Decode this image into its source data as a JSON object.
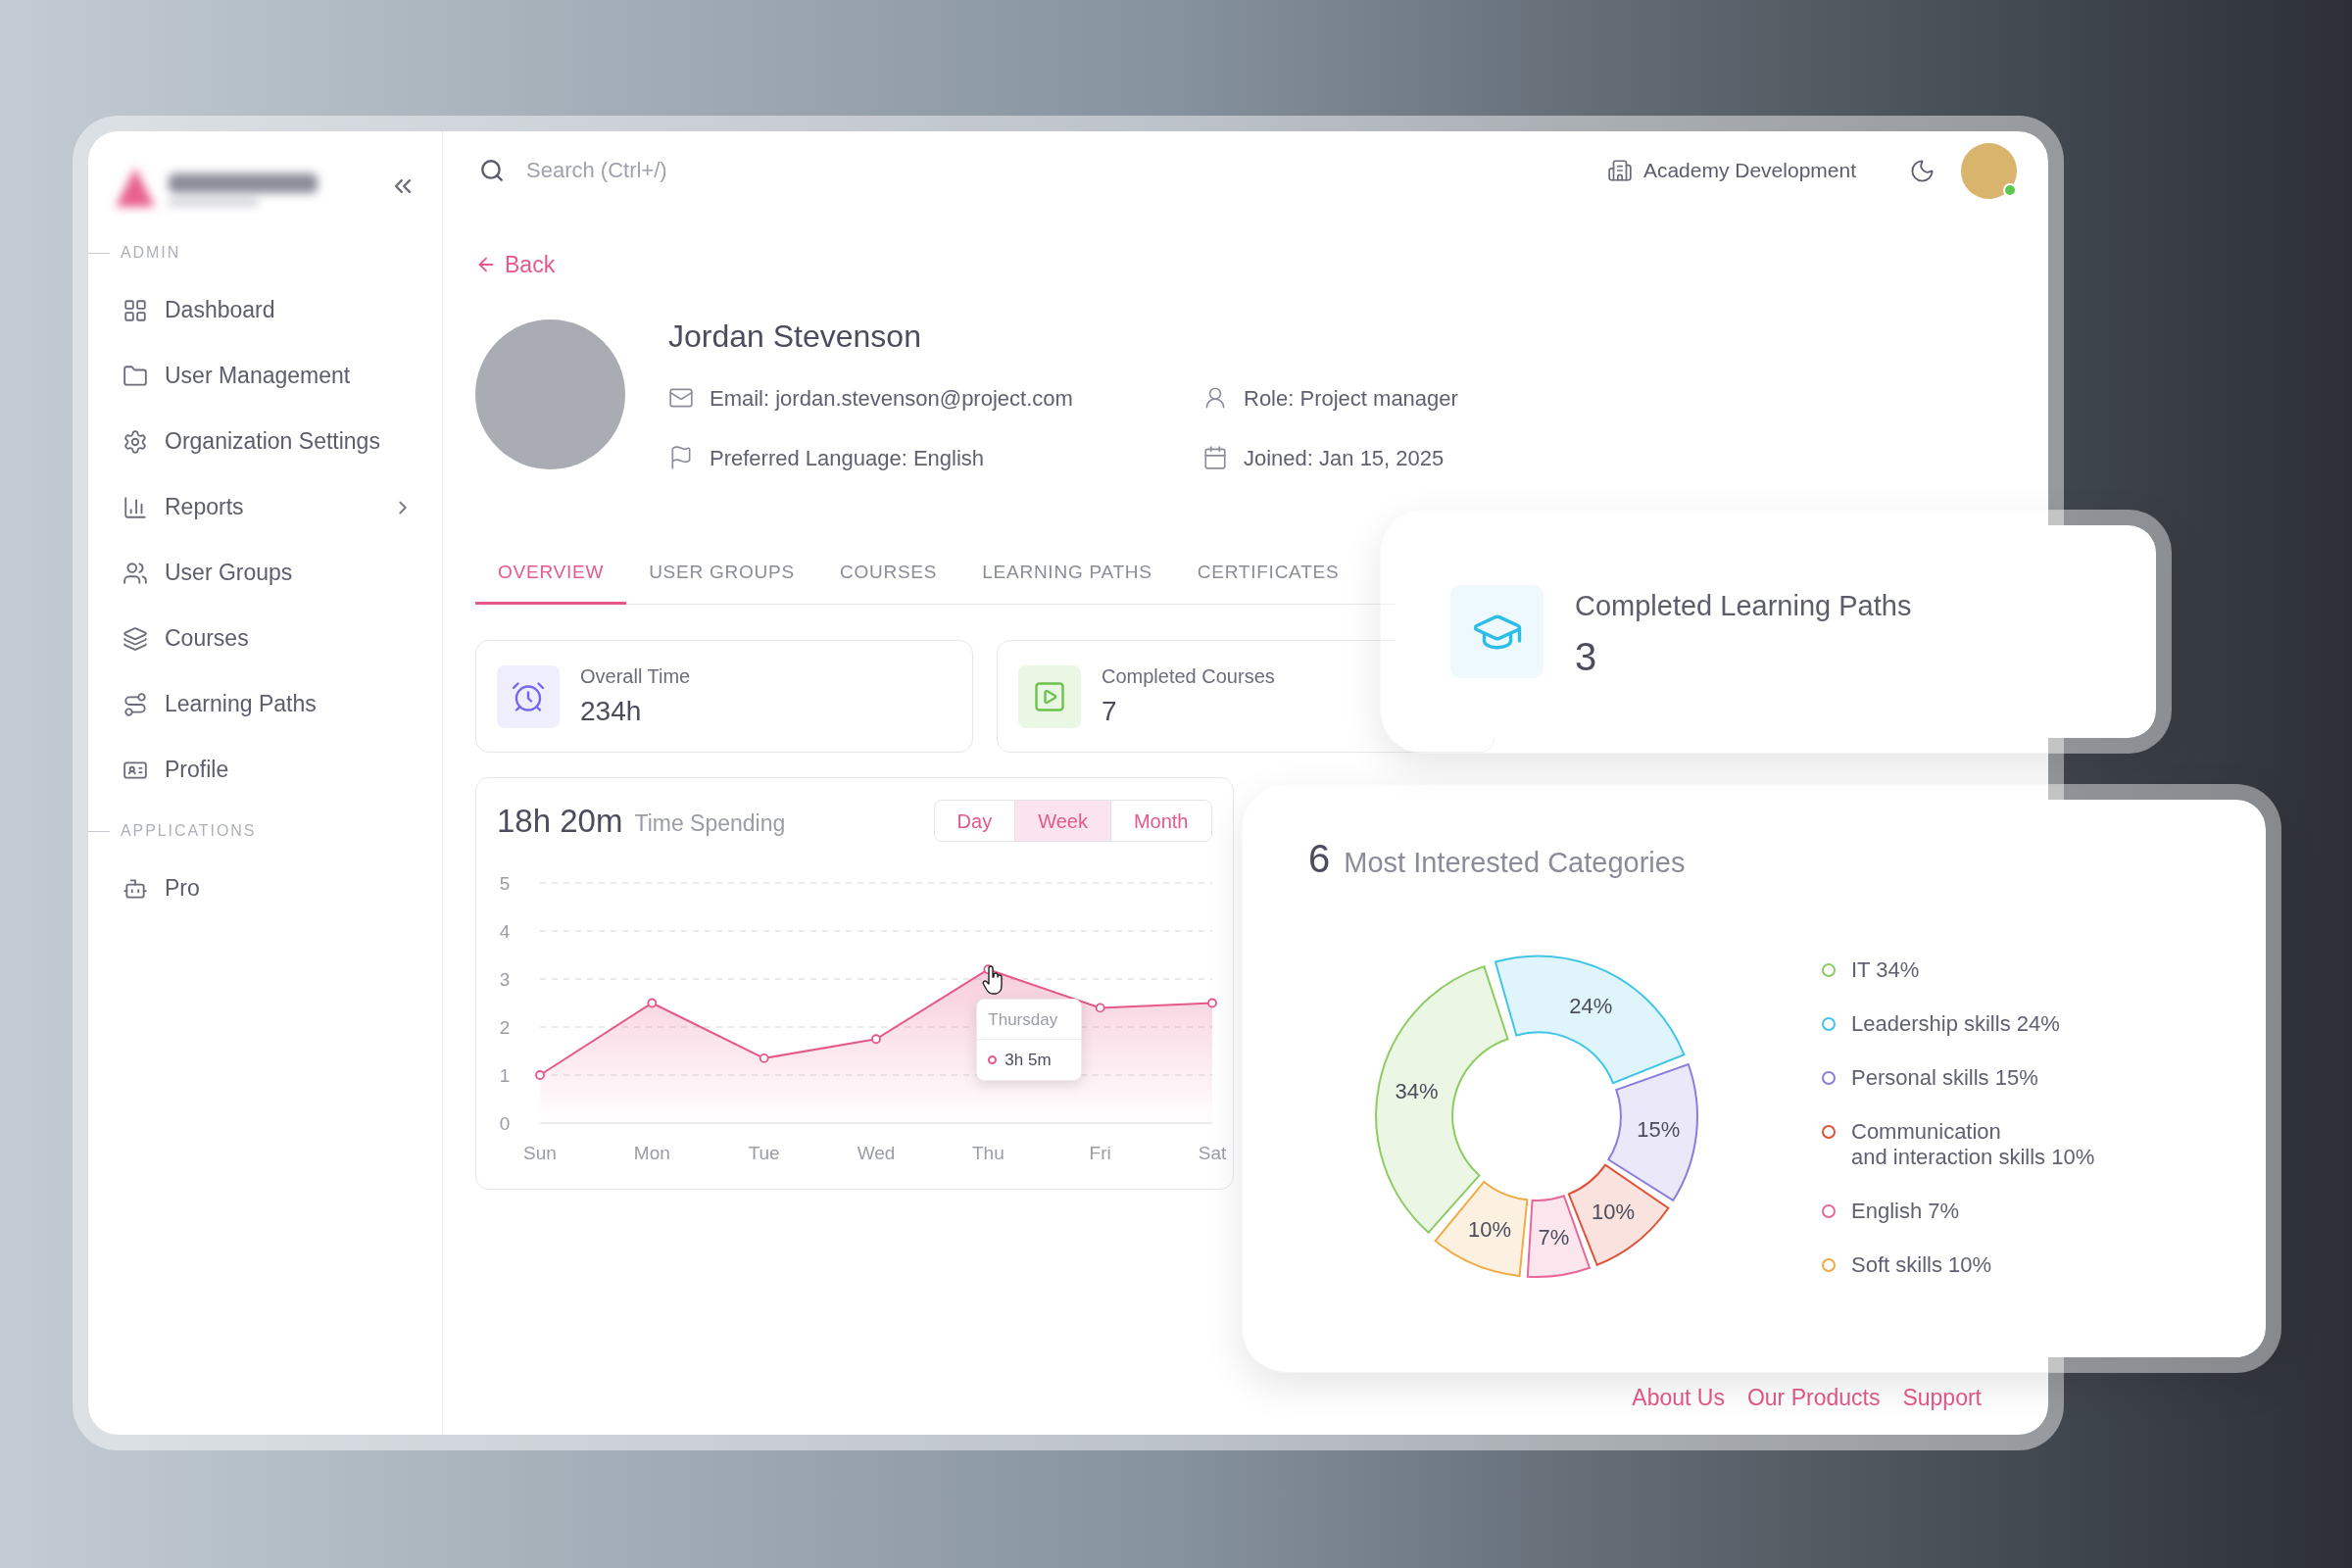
{
  "sidebar": {
    "sections": [
      {
        "title": "ADMIN",
        "items": [
          {
            "label": "Dashboard",
            "has_submenu": false
          },
          {
            "label": "User Management",
            "has_submenu": false
          },
          {
            "label": "Organization Settings",
            "has_submenu": false
          },
          {
            "label": "Reports",
            "has_submenu": true
          },
          {
            "label": "User Groups",
            "has_submenu": false
          },
          {
            "label": "Courses",
            "has_submenu": false
          },
          {
            "label": "Learning Paths",
            "has_submenu": false
          },
          {
            "label": "Profile",
            "has_submenu": false
          }
        ]
      },
      {
        "title": "APPLICATIONS",
        "items": [
          {
            "label": "Pro",
            "has_submenu": false
          }
        ]
      }
    ]
  },
  "topbar": {
    "search": {
      "placeholder": "Search (Ctrl+/)"
    },
    "organization": "Academy Development",
    "user": {
      "online": true
    }
  },
  "back_link": "Back",
  "profile": {
    "name": "Jordan Stevenson",
    "details": [
      "Email: jordan.stevenson@project.com",
      "Role: Project manager",
      "Preferred Language: English",
      "Joined: Jan 15, 2025"
    ]
  },
  "tabs": [
    {
      "label": "OVERVIEW",
      "selected": true
    },
    {
      "label": "USER GROUPS",
      "selected": false
    },
    {
      "label": "COURSES",
      "selected": false
    },
    {
      "label": "LEARNING PATHS",
      "selected": false
    },
    {
      "label": "CERTIFICATES",
      "selected": false
    }
  ],
  "stats": [
    {
      "label": "Overall Time",
      "value": "234h"
    },
    {
      "label": "Completed Courses",
      "value": "7"
    }
  ],
  "highlight_card": {
    "label": "Completed Learning Paths",
    "value": "3"
  },
  "time_spending": {
    "total": "18h 20m",
    "title": "Time Spending",
    "periods": [
      {
        "label": "Day",
        "selected": false
      },
      {
        "label": "Week",
        "selected": true
      },
      {
        "label": "Month",
        "selected": false
      }
    ],
    "chart_data": {
      "type": "area",
      "categories": [
        "Sun",
        "Mon",
        "Tue",
        "Wed",
        "Thu",
        "Fri",
        "Sat"
      ],
      "series": [
        {
          "color": "#e5588a",
          "values": [
            1,
            2.5,
            1.35,
            1.75,
            3.2,
            2.4,
            2.5
          ]
        }
      ],
      "ylim": [
        0,
        5
      ],
      "yticks": [
        0,
        1,
        2,
        3,
        4,
        5
      ],
      "grid": true
    },
    "tooltip": {
      "title": "Thursday",
      "value": "3h 5m"
    }
  },
  "categories_card": {
    "count": "6",
    "title": "Most Interested Categories",
    "chart_data": {
      "type": "donut",
      "values": [
        34,
        24,
        15,
        10,
        7,
        10
      ],
      "value_labels": [
        "34%",
        "24%",
        "15%",
        "10%",
        "7%",
        "10%"
      ]
    },
    "legend": [
      {
        "label": "IT 34%",
        "color": "#8ccc62"
      },
      {
        "label": "Leadership skills 24%",
        "color": "#3fc6e6"
      },
      {
        "label": "Personal skills 15%",
        "color": "#8a7ddb"
      },
      {
        "label": "Communication\nand interaction skills 10%",
        "color": "#e0523a"
      },
      {
        "label": "English 7%",
        "color": "#e8689a"
      },
      {
        "label": "Soft skills 10%",
        "color": "#f0ab45"
      }
    ]
  },
  "footer": {
    "links": [
      "About Us",
      "Our Products",
      "Support"
    ]
  }
}
